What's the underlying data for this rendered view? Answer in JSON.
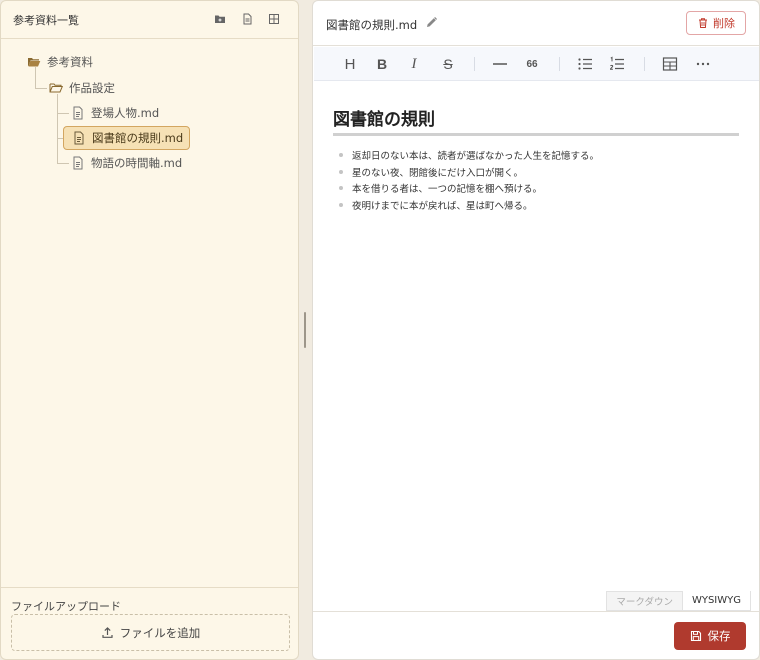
{
  "sidebar": {
    "title": "参考資料一覧",
    "tree": {
      "root": {
        "label": "参考資料",
        "icon": "folder-open-icon"
      },
      "folder": {
        "label": "作品設定",
        "icon": "folder-open-icon"
      },
      "files": [
        {
          "label": "登場人物.md",
          "icon": "file-icon",
          "selected": false
        },
        {
          "label": "図書館の規則.md",
          "icon": "file-icon",
          "selected": true
        },
        {
          "label": "物語の時間軸.md",
          "icon": "file-icon",
          "selected": false
        }
      ]
    },
    "upload": {
      "label": "ファイルアップロード",
      "button_label": "ファイルを追加"
    }
  },
  "editor": {
    "file_name": "図書館の規則.md",
    "delete_label": "削除",
    "save_label": "保存",
    "toolbar": {
      "heading": "H",
      "bold": "B",
      "italic": "I",
      "strike": "S",
      "quote": "66"
    },
    "document": {
      "heading": "図書館の規則",
      "items": [
        "返却日のない本は、読者が選ばなかった人生を記憶する。",
        "星のない夜、閉館後にだけ入口が開く。",
        "本を借りる者は、一つの記憶を棚へ預ける。",
        "夜明けまでに本が戻れば、星は町へ帰る。"
      ]
    },
    "modes": {
      "markdown": "マークダウン",
      "wysiwyg": "WYSIWYG",
      "active": "WYSIWYG"
    }
  },
  "colors": {
    "accent": "#b03a2e",
    "selection": "#f6e1b5",
    "sidebar_bg": "#fdf7e8",
    "folder_icon": "#8a6a30"
  }
}
